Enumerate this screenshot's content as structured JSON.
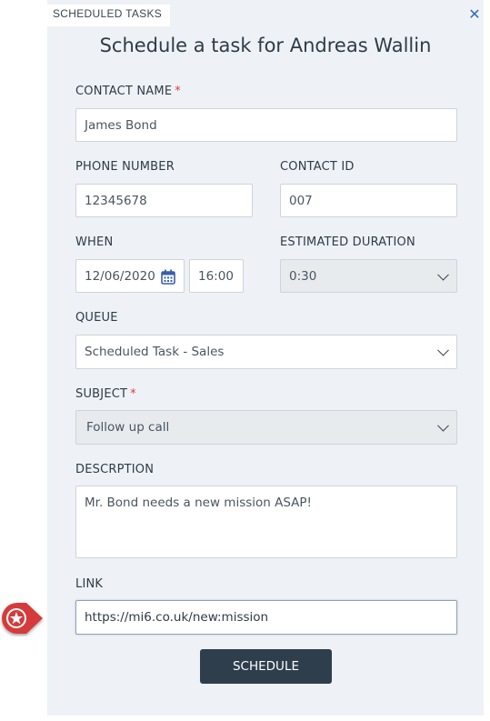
{
  "tab_label": "SCHEDULED TASKS",
  "title": "Schedule a task for Andreas Wallin",
  "contact_name": {
    "label": "CONTACT NAME",
    "required": "*",
    "value": "James Bond"
  },
  "phone_number": {
    "label": "PHONE NUMBER",
    "value": "12345678"
  },
  "contact_id": {
    "label": "CONTACT ID",
    "value": "007"
  },
  "when": {
    "label": "WHEN",
    "date": "12/06/2020",
    "time": "16:00"
  },
  "estimated_duration": {
    "label": "ESTIMATED DURATION",
    "value": "0:30"
  },
  "queue": {
    "label": "QUEUE",
    "value": "Scheduled Task - Sales"
  },
  "subject": {
    "label": "SUBJECT",
    "required": "*",
    "value": "Follow up call"
  },
  "description": {
    "label": "DESCRPTION",
    "value": "Mr. Bond needs a new mission ASAP!"
  },
  "link": {
    "label": "LINK",
    "value": "https://mi6.co.uk/new:mission"
  },
  "schedule_button": "SCHEDULE",
  "icons": {
    "close": "close-icon",
    "calendar": "calendar-icon",
    "chevron": "chevron-down-icon",
    "marker": "star-marker-icon"
  },
  "colors": {
    "panel": "#eef2f6",
    "button": "#2e3e4c",
    "required": "#e03c3c",
    "close": "#2f6bbf",
    "marker": "#d63a3a"
  }
}
